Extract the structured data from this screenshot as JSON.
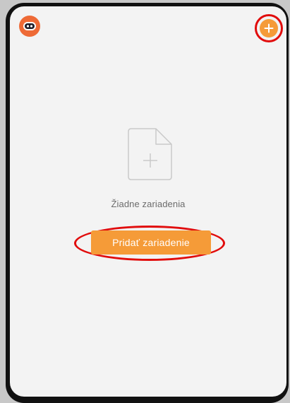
{
  "colors": {
    "accent": "#f59b38",
    "highlight_ring": "#e10c0c",
    "avatar": "#ee6a36",
    "screen_bg": "#f3f3f3"
  },
  "header": {
    "avatar_icon": "robot-avatar-icon",
    "add_icon": "plus-circle-icon"
  },
  "empty_state": {
    "icon": "add-document-icon",
    "message": "Žiadne zariadenia",
    "add_button_label": "Pridať zariadenie"
  }
}
